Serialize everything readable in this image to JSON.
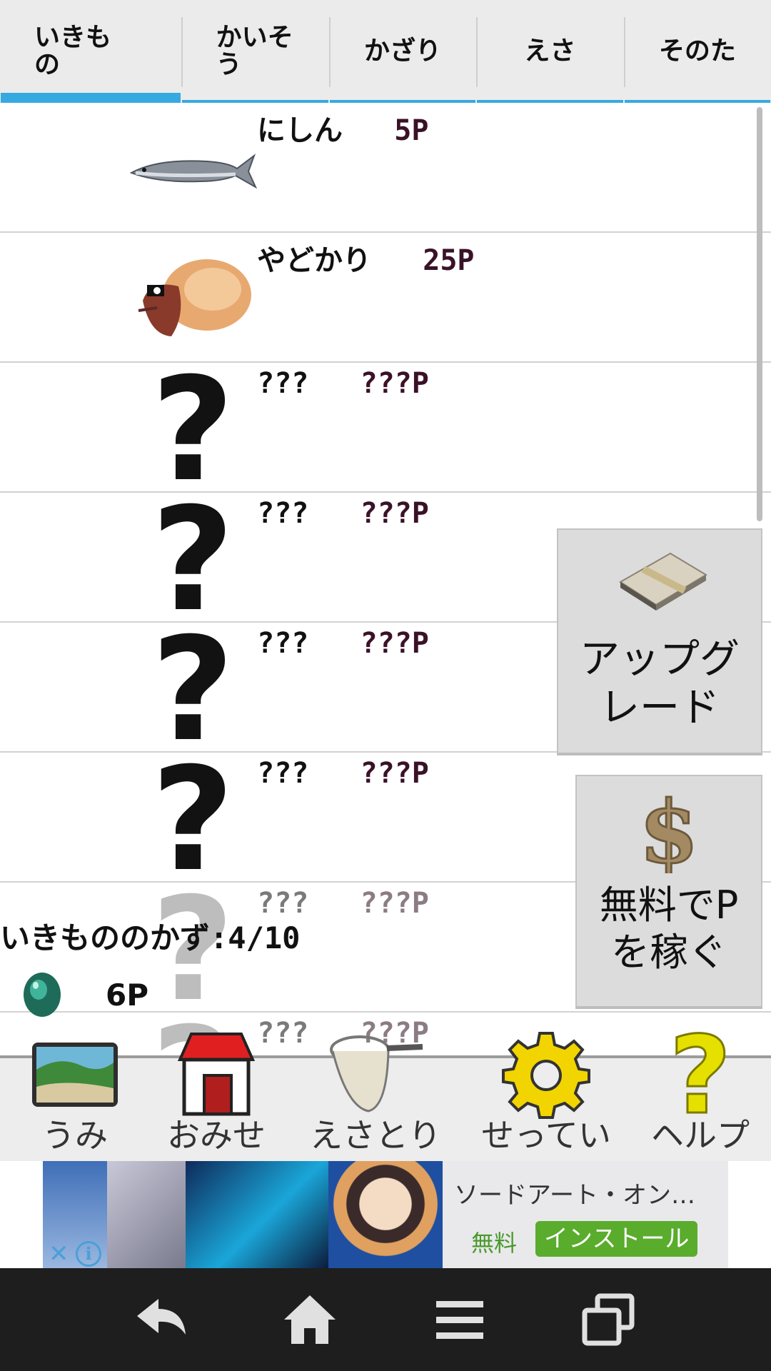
{
  "tabs": [
    {
      "label": "いきもの",
      "active": true
    },
    {
      "label": "かいそう",
      "active": false
    },
    {
      "label": "かざり",
      "active": false
    },
    {
      "label": "えさ",
      "active": false
    },
    {
      "label": "そのた",
      "active": false
    }
  ],
  "items": [
    {
      "name": "にしん",
      "price": "5P",
      "icon": "herring-fish-icon"
    },
    {
      "name": "やどかり",
      "price": "25P",
      "icon": "hermit-crab-icon"
    },
    {
      "name": "???",
      "price": "???P",
      "icon": "question-mark-icon"
    },
    {
      "name": "???",
      "price": "???P",
      "icon": "question-mark-icon"
    },
    {
      "name": "???",
      "price": "???P",
      "icon": "question-mark-icon"
    },
    {
      "name": "???",
      "price": "???P",
      "icon": "question-mark-icon"
    },
    {
      "name": "???",
      "price": "???P",
      "icon": "question-mark-icon"
    },
    {
      "name": "???",
      "price": "???P",
      "icon": "question-mark-icon"
    }
  ],
  "count_text": "いきもののかず:4/10",
  "points": {
    "value": "6P",
    "icon": "green-gem-icon"
  },
  "side_buttons": {
    "upgrade": {
      "label": "アップグレード",
      "icon": "money-stack-icon"
    },
    "earn": {
      "label": "無料でPを稼ぐ",
      "icon": "dollar-sign-icon"
    }
  },
  "bottom_nav": [
    {
      "label": "うみ",
      "icon": "beach-photo-icon"
    },
    {
      "label": "おみせ",
      "icon": "shop-icon"
    },
    {
      "label": "えさとり",
      "icon": "fishing-net-icon"
    },
    {
      "label": "せってい",
      "icon": "gear-icon"
    },
    {
      "label": "ヘルプ",
      "icon": "help-question-icon"
    }
  ],
  "ad": {
    "title": "ソードアート・オン…",
    "free_label": "無料",
    "install_label": "インストール",
    "close_glyph": "✕",
    "info_glyph": "i"
  },
  "system_nav": [
    "back-icon",
    "home-icon",
    "menu-icon",
    "recent-apps-icon"
  ],
  "colors": {
    "accent_tab": "#36a9e1",
    "price_text": "#3a1228",
    "install_green": "#5aac2c"
  }
}
